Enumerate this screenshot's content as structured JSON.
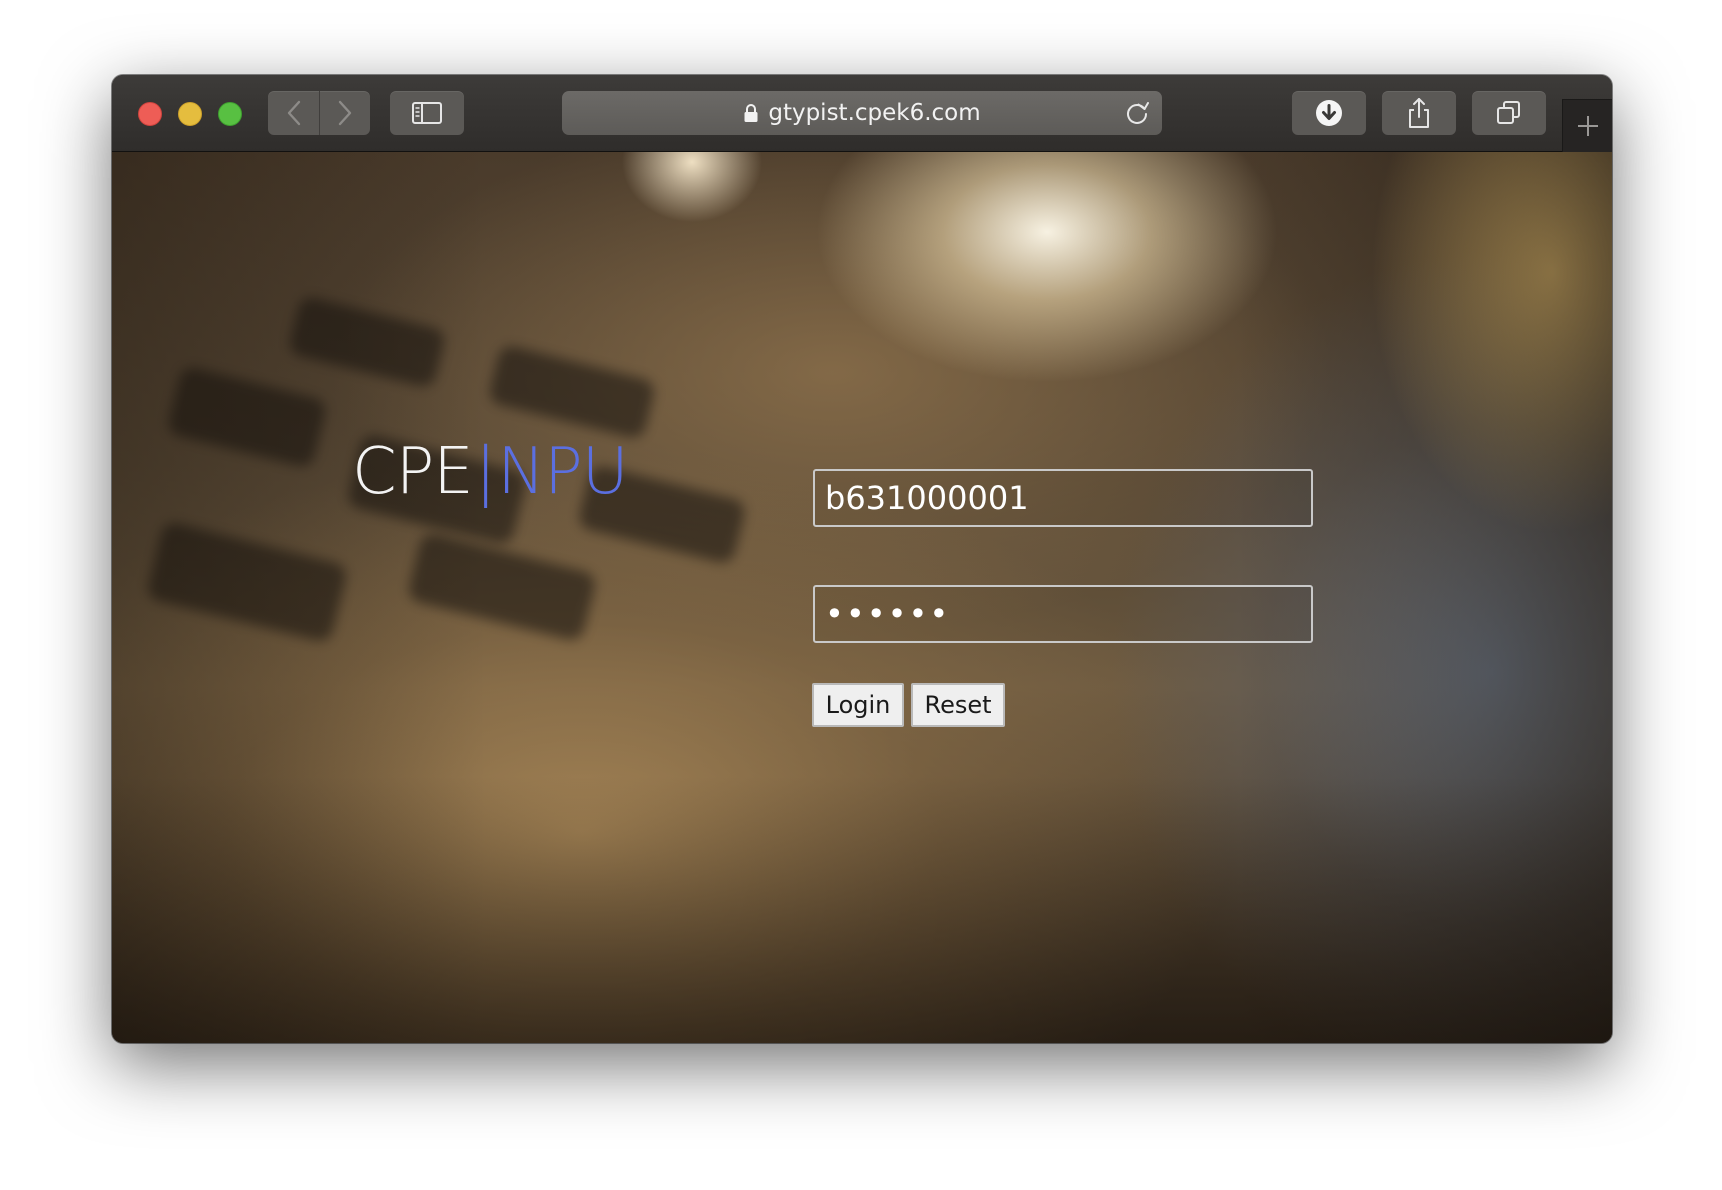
{
  "browser": {
    "url": "gtypist.cpek6.com",
    "icons": {
      "back": "chevron-left-icon",
      "forward": "chevron-right-icon",
      "sidebar": "sidebar-icon",
      "lock": "lock-icon",
      "reload": "reload-icon",
      "download": "download-icon",
      "share": "share-icon",
      "tabs": "tabs-icon",
      "new_tab": "plus-icon"
    }
  },
  "page": {
    "logo": {
      "part1": "CPE",
      "separator": "|",
      "part2": "NPU",
      "accent_color": "#5b6fe0"
    },
    "form": {
      "username_value": "b631000001",
      "password_value": "••••••",
      "login_label": "Login",
      "reset_label": "Reset"
    }
  }
}
